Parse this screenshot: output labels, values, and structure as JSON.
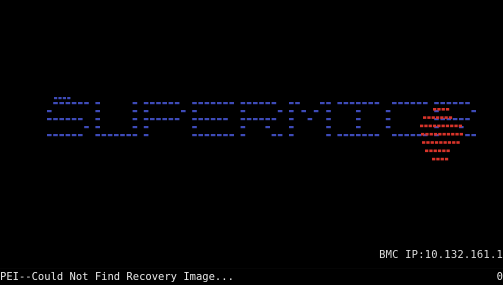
{
  "screen": {
    "background": "#000000",
    "logo": {
      "brand": "SUPERMICR",
      "blue_color": "#3e4bb8",
      "red_color": "#d8342a"
    },
    "bmc_ip": "BMC IP:10.132.161.1",
    "status_message": "PEI--Could Not Find Recovery Image...",
    "post_code": "0"
  }
}
